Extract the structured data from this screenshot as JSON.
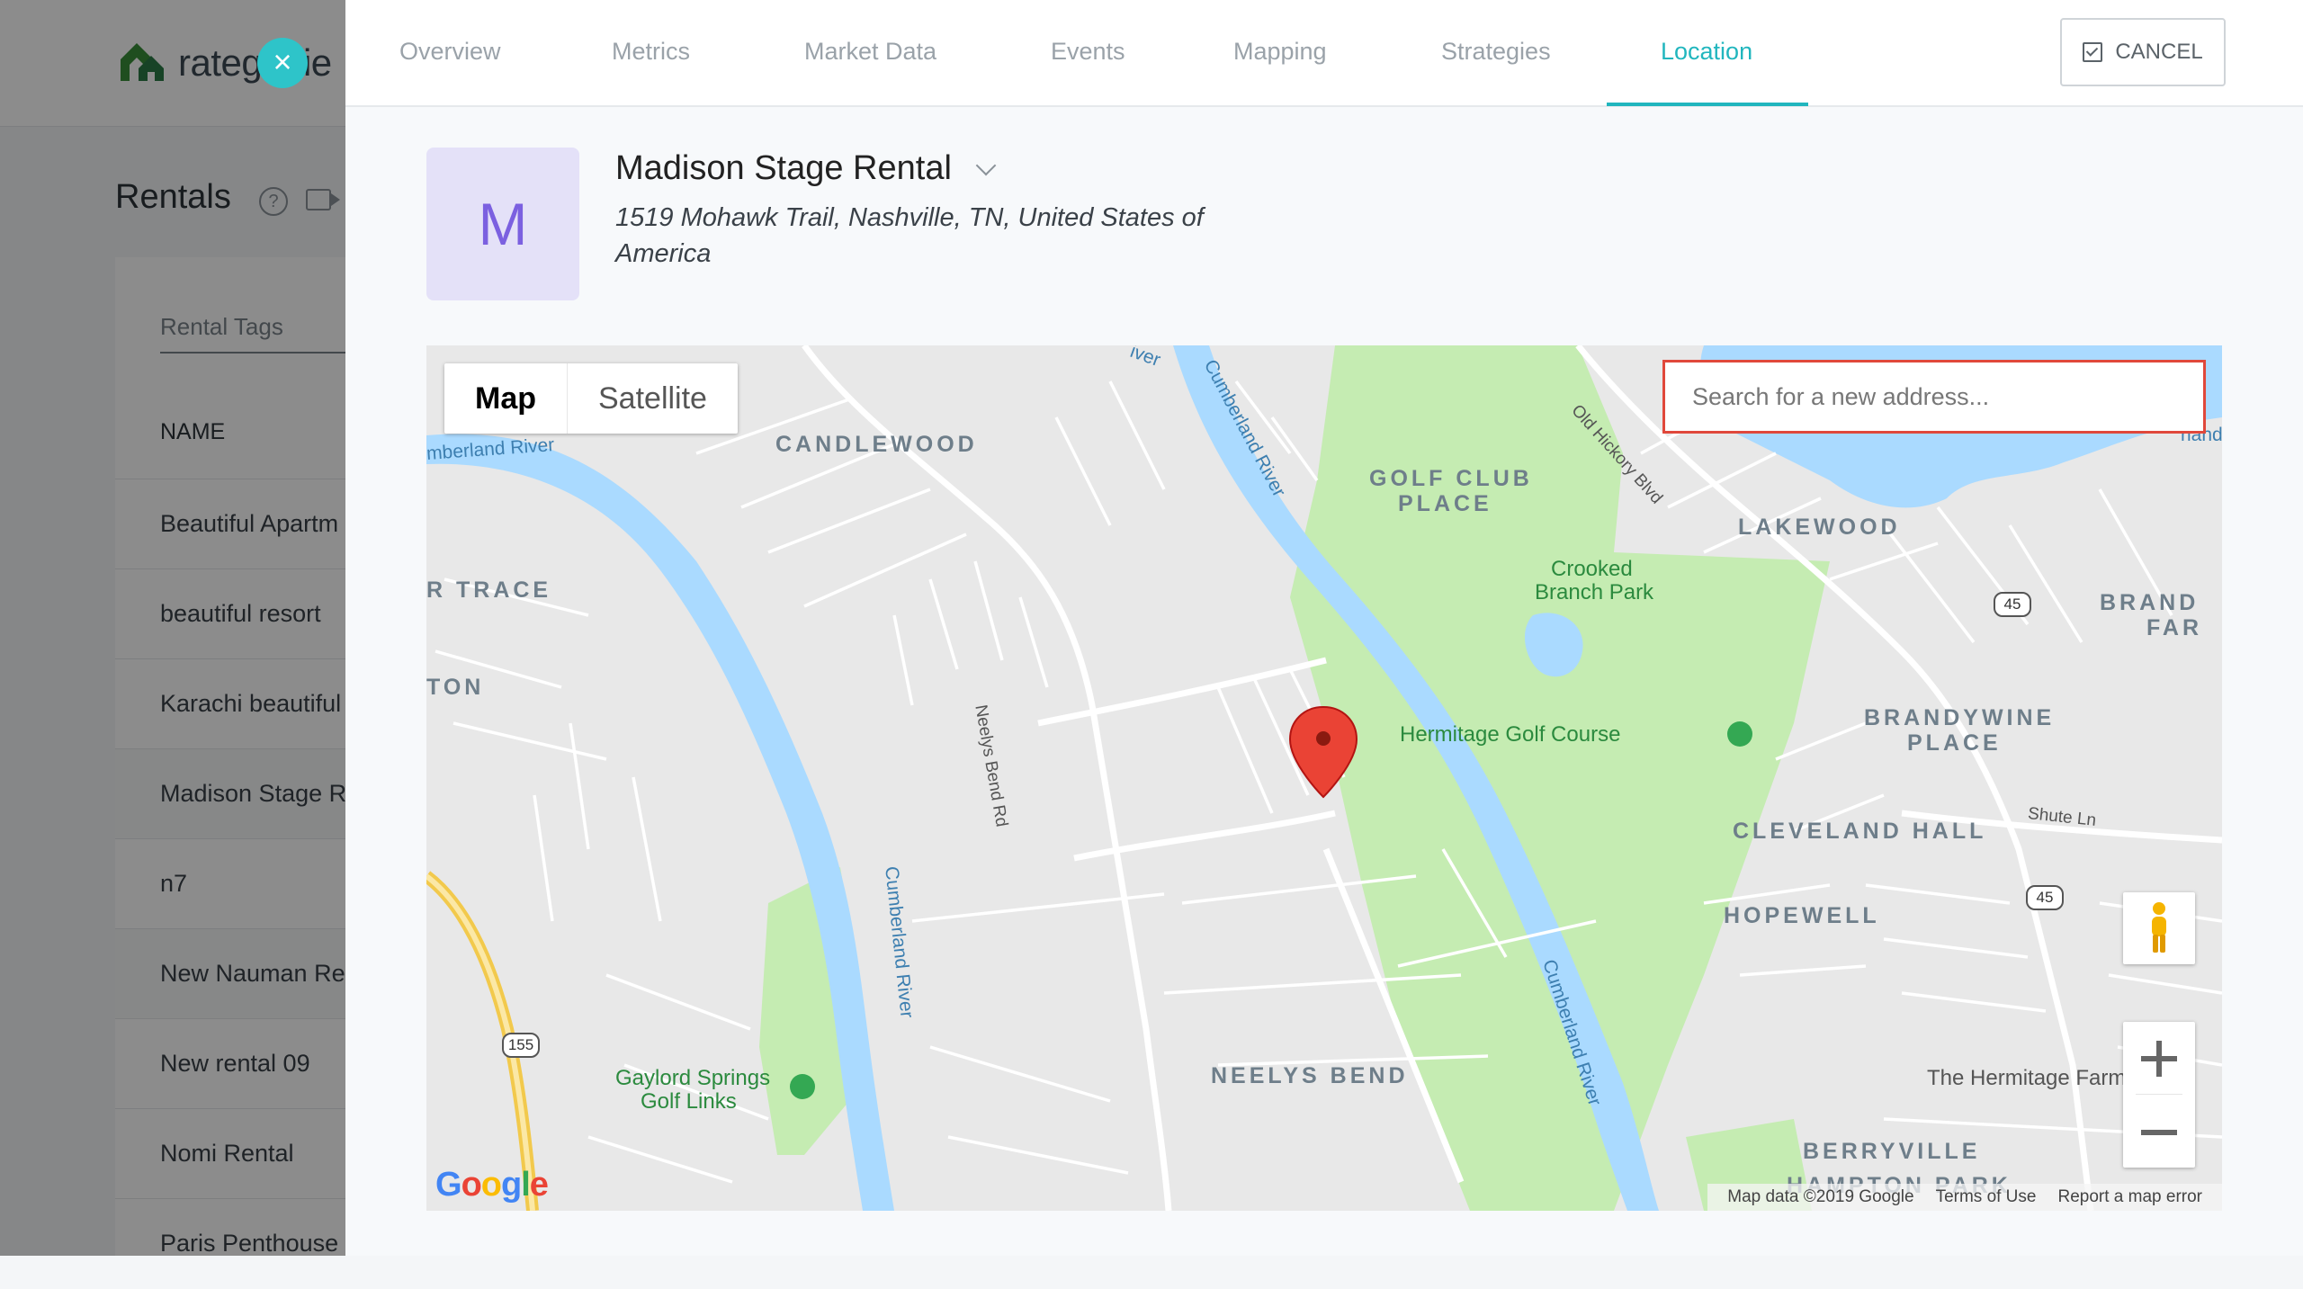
{
  "app": {
    "logo_text": "rategenie",
    "page_title": "Rentals",
    "rental_tags_label": "Rental Tags",
    "name_column": "NAME",
    "rentals": [
      "Beautiful Apartm",
      "beautiful resort",
      "Karachi beautiful",
      "Madison Stage Re",
      "n7",
      "New Nauman Re",
      "New rental 09",
      "Nomi Rental",
      "Paris Penthouse"
    ]
  },
  "panel": {
    "tabs": [
      {
        "label": "Overview"
      },
      {
        "label": "Metrics"
      },
      {
        "label": "Market Data"
      },
      {
        "label": "Events"
      },
      {
        "label": "Mapping"
      },
      {
        "label": "Strategies"
      },
      {
        "label": "Location",
        "active": true
      }
    ],
    "cancel_label": "CANCEL",
    "avatar_letter": "M",
    "rental_name": "Madison Stage Rental",
    "rental_address": "1519 Mohawk Trail, Nashville, TN, United States of America"
  },
  "map": {
    "map_type_options": [
      "Map",
      "Satellite"
    ],
    "selected_map_type": "Map",
    "search_placeholder": "Search for a new address...",
    "areas": [
      "CANDLEWOOD",
      "GOLF CLUB",
      "PLACE",
      "LAKEWOOD",
      "R TRACE",
      "TON",
      "BRAND",
      "FAR",
      "BRANDYWINE",
      "PLACE",
      "CLEVELAND HALL",
      "HOPEWELL",
      "NEELYS BEND",
      "BERRYVILLE",
      "HAMPTON PARK"
    ],
    "pois": [
      "Crooked",
      "Branch Park",
      "Hermitage Golf Course",
      "Gaylord Springs",
      "Golf Links",
      "The Hermitage Farm"
    ],
    "roads": [
      "Old Hickory Blvd",
      "Neelys Bend Rd",
      "Shute Ln"
    ],
    "rivers": [
      "Cumberland River",
      "Cumberland River",
      "Cumberland River",
      "mberland River",
      "iver",
      "rland"
    ],
    "shields": [
      "45",
      "45",
      "155"
    ],
    "google": "Google",
    "footer": {
      "map_data": "Map data ©2019 Google",
      "terms": "Terms of Use",
      "report": "Report a map error"
    },
    "colors": {
      "water": "#aadaff",
      "park": "#c5ecb2",
      "land": "#e8e8e8",
      "road": "#ffffff",
      "highway": "#f9dc7c",
      "marker": "#ea4335"
    }
  },
  "colors": {
    "accent": "#21b6be",
    "avatar_bg": "#e4e1f8",
    "avatar_text": "#7b60e0",
    "search_border": "#e0483b"
  }
}
